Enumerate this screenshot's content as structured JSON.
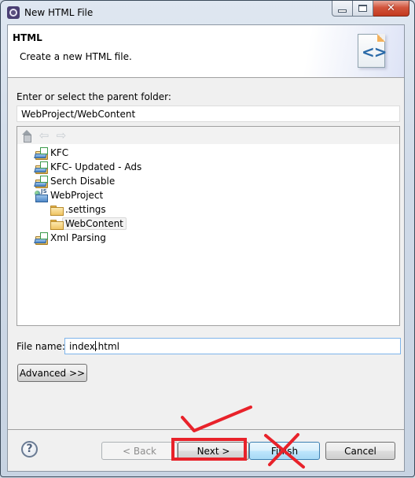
{
  "window": {
    "title": "New HTML File",
    "controls": {
      "minimize": "minimize-icon",
      "maximize": "maximize-icon",
      "close": "close-icon",
      "close_glyph": "✕"
    }
  },
  "banner": {
    "title": "HTML",
    "description": "Create a new HTML file.",
    "icon": "html-file-icon",
    "icon_glyph": "<>"
  },
  "parent_folder": {
    "label": "Enter or select the parent folder:",
    "value": "WebProject/WebContent"
  },
  "tree_toolbar": {
    "home": "home-icon",
    "back": "back-arrow-icon",
    "back_glyph": "⇦",
    "forward": "forward-arrow-icon",
    "forward_glyph": "⇨"
  },
  "tree": [
    {
      "label": "KFC",
      "icon": "project-icon",
      "level": 0,
      "selected": false
    },
    {
      "label": "KFC- Updated - Ads",
      "icon": "project-icon",
      "level": 0,
      "selected": false
    },
    {
      "label": "Serch Disable",
      "icon": "project-icon",
      "level": 0,
      "selected": false
    },
    {
      "label": "WebProject",
      "icon": "web-project-icon",
      "level": 0,
      "selected": false
    },
    {
      "label": ".settings",
      "icon": "folder-icon",
      "level": 1,
      "selected": false
    },
    {
      "label": "WebContent",
      "icon": "folder-icon",
      "level": 1,
      "selected": true
    },
    {
      "label": "Xml Parsing",
      "icon": "project-icon",
      "level": 0,
      "selected": false
    }
  ],
  "file_name": {
    "label": "File name:",
    "value_before_caret": "index",
    "value_after_caret": ".html",
    "value": "index.html"
  },
  "buttons": {
    "advanced": "Advanced >>",
    "back": "< Back",
    "next": "Next >",
    "finish": "Finish",
    "cancel": "Cancel",
    "help_glyph": "?"
  },
  "annotations": {
    "color": "#e8222a",
    "next": "checkmark + highlight box",
    "finish": "cross-out"
  }
}
